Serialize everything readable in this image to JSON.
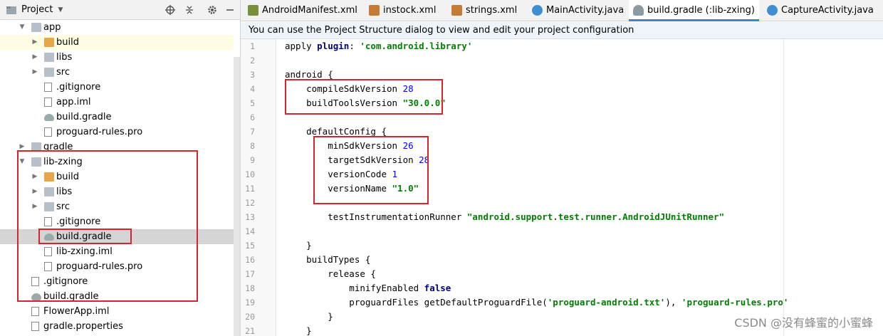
{
  "project_panel": {
    "title": "Project",
    "tree": [
      {
        "label": "app",
        "type": "module",
        "expanded": true
      },
      {
        "label": "build",
        "type": "folder-excluded",
        "expanded": false
      },
      {
        "label": "libs",
        "type": "folder",
        "expanded": false
      },
      {
        "label": "src",
        "type": "folder",
        "expanded": false
      },
      {
        "label": ".gitignore",
        "type": "file"
      },
      {
        "label": "app.iml",
        "type": "file"
      },
      {
        "label": "build.gradle",
        "type": "gradle"
      },
      {
        "label": "proguard-rules.pro",
        "type": "file"
      },
      {
        "label": "gradle",
        "type": "folder",
        "expanded": false
      },
      {
        "label": "lib-zxing",
        "type": "module",
        "expanded": true
      },
      {
        "label": "build",
        "type": "folder-excluded",
        "expanded": false
      },
      {
        "label": "libs",
        "type": "folder",
        "expanded": false
      },
      {
        "label": "src",
        "type": "folder",
        "expanded": false
      },
      {
        "label": ".gitignore",
        "type": "file"
      },
      {
        "label": "build.gradle",
        "type": "gradle",
        "selected": true
      },
      {
        "label": "lib-zxing.iml",
        "type": "file"
      },
      {
        "label": "proguard-rules.pro",
        "type": "file"
      },
      {
        "label": ".gitignore",
        "type": "file"
      },
      {
        "label": "build.gradle",
        "type": "gradle"
      },
      {
        "label": "FlowerApp.iml",
        "type": "file"
      },
      {
        "label": "gradle.properties",
        "type": "file"
      }
    ]
  },
  "tabs": [
    {
      "label": "AndroidManifest.xml",
      "icon": "MF"
    },
    {
      "label": "instock.xml",
      "icon": "<>"
    },
    {
      "label": "strings.xml",
      "icon": "<>"
    },
    {
      "label": "MainActivity.java",
      "icon": "C"
    },
    {
      "label": "build.gradle (:lib-zxing)",
      "icon": "gradle",
      "active": true
    },
    {
      "label": "CaptureActivity.java",
      "icon": "C"
    }
  ],
  "notice": "You can use the Project Structure dialog to view and edit your project configuration",
  "code": {
    "line_numbers": [
      "1",
      "2",
      "3",
      "4",
      "5",
      "6",
      "7",
      "8",
      "9",
      "10",
      "11",
      "12",
      "13",
      "14",
      "15",
      "16",
      "17",
      "18",
      "19",
      "20",
      "21"
    ],
    "lines": [
      [
        {
          "t": "apply ",
          "c": ""
        },
        {
          "t": "plugin",
          "c": "kw"
        },
        {
          "t": ": ",
          "c": ""
        },
        {
          "t": "'com.android.library'",
          "c": "str"
        }
      ],
      [],
      [
        {
          "t": "android {",
          "c": ""
        }
      ],
      [
        {
          "t": "    compileSdkVersion ",
          "c": ""
        },
        {
          "t": "28",
          "c": "num"
        }
      ],
      [
        {
          "t": "    buildToolsVersion ",
          "c": ""
        },
        {
          "t": "\"30.0.0\"",
          "c": "str"
        }
      ],
      [],
      [
        {
          "t": "    defaultConfig {",
          "c": ""
        }
      ],
      [
        {
          "t": "        minSdkVersion ",
          "c": ""
        },
        {
          "t": "26",
          "c": "num"
        }
      ],
      [
        {
          "t": "        targetSdkVersion ",
          "c": ""
        },
        {
          "t": "28",
          "c": "num"
        }
      ],
      [
        {
          "t": "        versionCode ",
          "c": ""
        },
        {
          "t": "1",
          "c": "num"
        }
      ],
      [
        {
          "t": "        versionName ",
          "c": ""
        },
        {
          "t": "\"1.0\"",
          "c": "str"
        }
      ],
      [],
      [
        {
          "t": "        testInstrumentationRunner ",
          "c": ""
        },
        {
          "t": "\"android.support.test.runner.AndroidJUnitRunner\"",
          "c": "str"
        }
      ],
      [],
      [
        {
          "t": "    }",
          "c": ""
        }
      ],
      [
        {
          "t": "    buildTypes {",
          "c": ""
        }
      ],
      [
        {
          "t": "        release {",
          "c": ""
        }
      ],
      [
        {
          "t": "            minifyEnabled ",
          "c": ""
        },
        {
          "t": "false",
          "c": "kw"
        }
      ],
      [
        {
          "t": "            proguardFiles getDefaultProguardFile(",
          "c": ""
        },
        {
          "t": "'proguard-android.txt'",
          "c": "str"
        },
        {
          "t": "), ",
          "c": ""
        },
        {
          "t": "'proguard-rules.pro'",
          "c": "str"
        }
      ],
      [
        {
          "t": "        }",
          "c": ""
        }
      ],
      [
        {
          "t": "    }",
          "c": ""
        }
      ]
    ]
  },
  "watermark": "CSDN @没有蜂蜜的小蜜蜂",
  "colors": {
    "highlight_box": "#d8252c",
    "active_tab": "#4083c9",
    "string": "#008000",
    "keyword": "#000080",
    "number": "#0000ff"
  }
}
